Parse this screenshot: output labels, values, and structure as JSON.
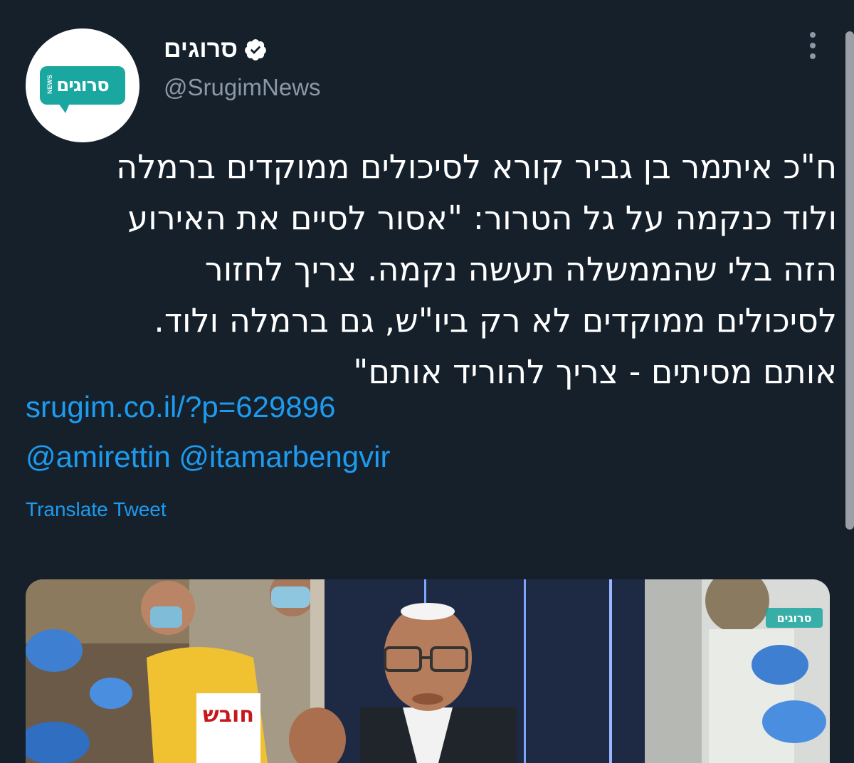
{
  "account": {
    "display_name": "סרוגים",
    "handle": "@SrugimNews",
    "logo_text": "סרוגים",
    "logo_sub": "NEWS"
  },
  "tweet": {
    "lines": [
      "ח\"כ איתמר בן גביר קורא לסיכולים ממוקדים ברמלה",
      "ולוד כנקמה על גל הטרור: \"אסור לסיים את האירוע",
      "הזה בלי שהממשלה תעשה נקמה. צריך לחזור",
      "לסיכולים ממוקדים לא רק ביו\"ש, גם ברמלה ולוד.",
      "אותם מסיתים - צריך להוריד אותם\""
    ],
    "link": "srugim.co.il/?p=629896",
    "mentions": [
      "@amirettin",
      "@itamarbengvir"
    ],
    "translate_label": "Translate Tweet"
  },
  "media": {
    "watermark": "סרוגים",
    "vest_text": "חובש"
  },
  "colors": {
    "background": "#15202b",
    "link": "#1d9bf0",
    "secondary_text": "#8b98a5",
    "brand": "#1aa7a0"
  }
}
